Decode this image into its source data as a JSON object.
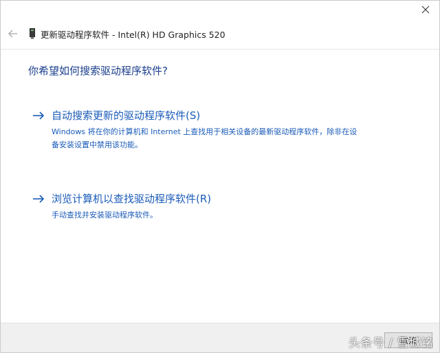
{
  "window": {
    "title": "更新驱动程序软件 - Intel(R) HD Graphics 520"
  },
  "icons": {
    "close": "close-icon",
    "back": "back-arrow-icon",
    "device": "display-adapter-icon",
    "option_arrow": "right-arrow-icon"
  },
  "main": {
    "heading": "你希望如何搜索驱动程序软件?",
    "options": [
      {
        "title": "自动搜索更新的驱动程序软件(S)",
        "description": "Windows 将在你的计算机和 Internet 上查找用于相关设备的最新驱动程序软件，除非在设备安装设置中禁用该功能。"
      },
      {
        "title": "浏览计算机以查找驱动程序软件(R)",
        "description": "手动查找并安装驱动程序软件。"
      }
    ]
  },
  "footer": {
    "cancel_label": "取消"
  },
  "watermark": {
    "text": "头条号 / 雪城铭"
  },
  "colors": {
    "link_blue": "#1a5bb8",
    "heading_blue": "#1a3e8c",
    "footer_bg": "#f0f0f0"
  }
}
